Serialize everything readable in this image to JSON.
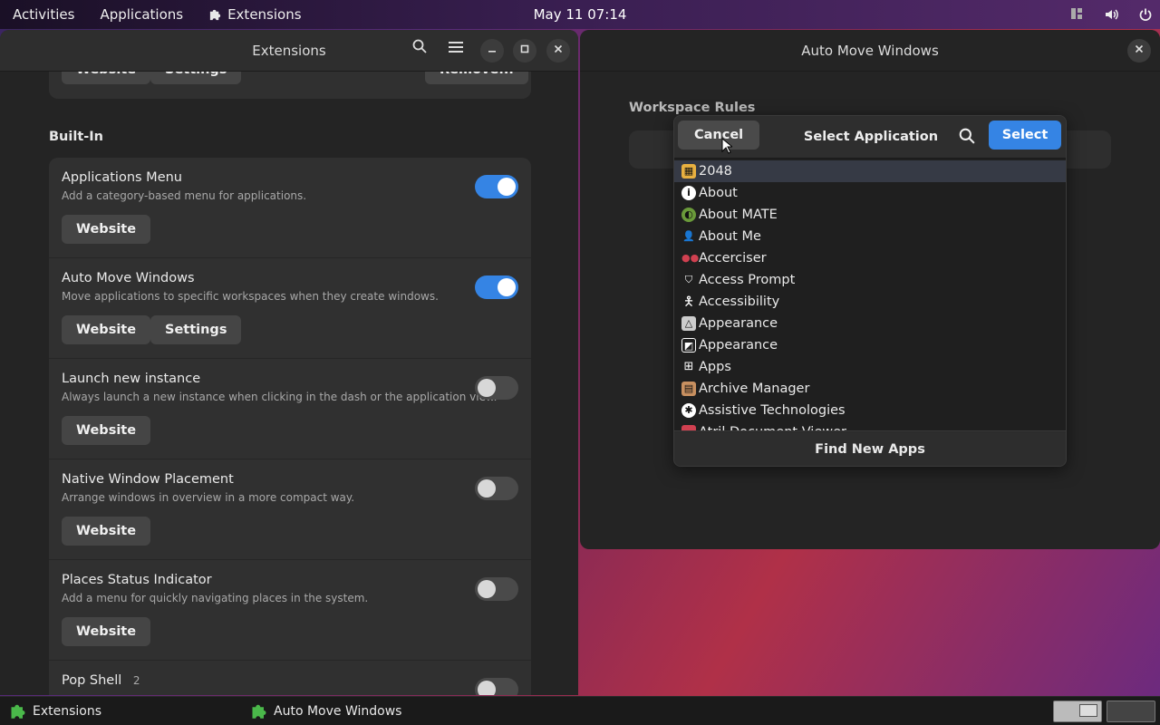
{
  "topbar": {
    "activities": "Activities",
    "applications": "Applications",
    "active_app": "Extensions",
    "clock": "May 11  07:14",
    "icons": [
      "workspace-icon",
      "volume-icon",
      "power-icon"
    ]
  },
  "extensions_window": {
    "title": "Extensions",
    "partial_row": {
      "website": "Website",
      "settings": "Settings",
      "remove": "Remove..."
    },
    "section_builtin": "Built-In",
    "rows": [
      {
        "title": "Applications Menu",
        "desc": "Add a category-based menu for applications.",
        "enabled": true,
        "website": "Website"
      },
      {
        "title": "Auto Move Windows",
        "desc": "Move applications to specific workspaces when they create windows.",
        "enabled": true,
        "website": "Website",
        "settings": "Settings"
      },
      {
        "title": "Launch new instance",
        "desc": "Always launch a new instance when clicking in the dash or the application view.",
        "enabled": false,
        "website": "Website"
      },
      {
        "title": "Native Window Placement",
        "desc": "Arrange windows in overview in a more compact way.",
        "enabled": false,
        "website": "Website"
      },
      {
        "title": "Places Status Indicator",
        "desc": "Add a menu for quickly navigating places in the system.",
        "enabled": false,
        "website": "Website"
      },
      {
        "title": "Pop Shell",
        "badge": "2",
        "enabled": false
      }
    ]
  },
  "amw_window": {
    "title": "Auto Move Windows",
    "section": "Workspace Rules"
  },
  "dialog": {
    "cancel": "Cancel",
    "title": "Select Application",
    "select": "Select",
    "apps": [
      {
        "label": "2048",
        "icon": "2048-icon",
        "color": "#e8b040"
      },
      {
        "label": "About",
        "icon": "info-icon",
        "color": "#ffffff"
      },
      {
        "label": "About MATE",
        "icon": "mate-icon",
        "color": "#6a9a3a"
      },
      {
        "label": "About Me",
        "icon": "person-icon",
        "color": "#ffffff"
      },
      {
        "label": "Accerciser",
        "icon": "accerciser-icon",
        "color": "#d04050"
      },
      {
        "label": "Access Prompt",
        "icon": "shield-icon",
        "color": "#ffffff"
      },
      {
        "label": "Accessibility",
        "icon": "accessibility-icon",
        "color": "#ffffff"
      },
      {
        "label": "Appearance",
        "icon": "appearance-icon",
        "color": "#cccccc"
      },
      {
        "label": "Appearance",
        "icon": "appearance-alt-icon",
        "color": "#ffffff"
      },
      {
        "label": "Apps",
        "icon": "apps-grid-icon",
        "color": "#ffffff"
      },
      {
        "label": "Archive Manager",
        "icon": "archive-icon",
        "color": "#c89060"
      },
      {
        "label": "Assistive Technologies",
        "icon": "assistive-icon",
        "color": "#ffffff"
      },
      {
        "label": "Atril Document Viewer",
        "icon": "atril-icon",
        "color": "#d04050"
      }
    ],
    "find_new": "Find New Apps"
  },
  "taskbar": {
    "tasks": [
      "Extensions",
      "Auto Move Windows"
    ]
  }
}
